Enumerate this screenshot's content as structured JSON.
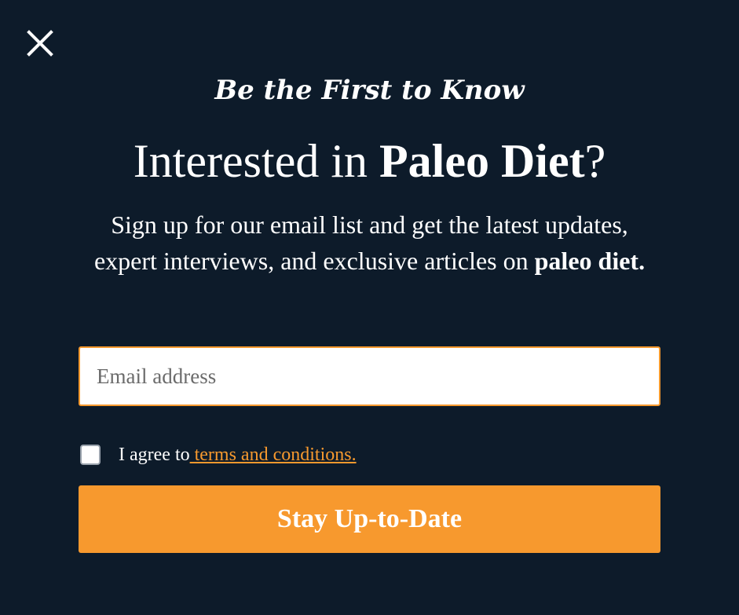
{
  "modal": {
    "close_icon": "close-icon",
    "kicker": "Be the First to Know",
    "headline": {
      "prefix": "Interested in ",
      "topic": "Paleo Diet",
      "suffix": "?"
    },
    "subtext": {
      "main": "Sign up for our email list and get the latest updates, expert interviews, and exclusive articles on ",
      "topic": "paleo diet."
    },
    "email": {
      "placeholder": "Email address",
      "value": ""
    },
    "consent": {
      "checked": false,
      "text": "I agree to",
      "link_text": " terms and conditions."
    },
    "submit_label": "Stay Up-to-Date",
    "colors": {
      "background": "#0d1b2a",
      "accent": "#f7992e",
      "text": "#ffffff"
    }
  }
}
